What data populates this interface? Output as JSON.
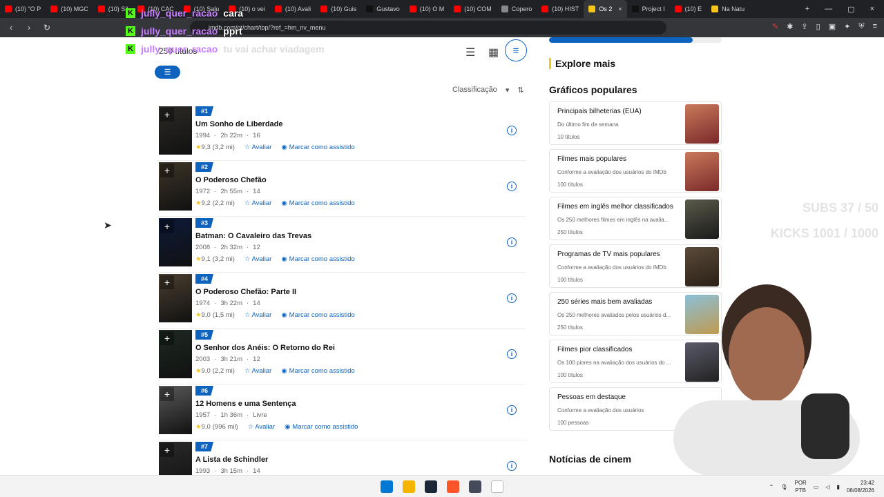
{
  "browser": {
    "tabs": [
      {
        "label": "(10) \"O P",
        "color": "#ff0000"
      },
      {
        "label": "(10) MGC",
        "color": "#ff0000"
      },
      {
        "label": "(10) Sil",
        "color": "#ff0000"
      },
      {
        "label": "(10) CAC",
        "color": "#ff0000"
      },
      {
        "label": "(10) Salu",
        "color": "#ff0000"
      },
      {
        "label": "(10) o vei",
        "color": "#ff0000"
      },
      {
        "label": "(10) Avali",
        "color": "#ff0000"
      },
      {
        "label": "(10) Guis",
        "color": "#ff0000"
      },
      {
        "label": "Gustavo",
        "color": "#111111"
      },
      {
        "label": "(10) O M",
        "color": "#ff0000"
      },
      {
        "label": "(10) COM",
        "color": "#ff0000"
      },
      {
        "label": "Copero",
        "color": "#888888"
      },
      {
        "label": "(10) HIST",
        "color": "#ff0000"
      },
      {
        "label": "Os 2",
        "color": "#f5c518",
        "active": true
      },
      {
        "label": "Project I",
        "color": "#111111"
      },
      {
        "label": "(10) E",
        "color": "#ff0000"
      },
      {
        "label": "Na Natu",
        "color": "#f5c518"
      }
    ],
    "url": "imdb.com/pt/chart/top/?ref_=hm_nv_menu",
    "tab_close": "×",
    "new_tab": "+"
  },
  "chat": [
    {
      "user": "jully_quer_racao",
      "message": "cara"
    },
    {
      "user": "jully_quer_racao",
      "message": "pprt"
    },
    {
      "user": "jully_quer_racao",
      "message": "tu vai achar viadagem"
    }
  ],
  "chat_badge": "K",
  "view": {
    "count": "250 títulos",
    "list_icon": "☰",
    "grid_icon": "▦",
    "menu_icon": "≡",
    "filter_icon": "☰",
    "sort_label": "Classificação",
    "sort_caret": "▾",
    "sort_toggle": "⇅"
  },
  "movies": [
    {
      "rank": "#1",
      "title": "Um Sonho de Liberdade",
      "year": "1994",
      "duration": "2h 22m",
      "rating_age": "16",
      "rating": "9,3",
      "votes": "(3,2 mi)"
    },
    {
      "rank": "#2",
      "title": "O Poderoso Chefão",
      "year": "1972",
      "duration": "2h 55m",
      "rating_age": "14",
      "rating": "9,2",
      "votes": "(2,2 mi)"
    },
    {
      "rank": "#3",
      "title": "Batman: O Cavaleiro das Trevas",
      "year": "2008",
      "duration": "2h 32m",
      "rating_age": "12",
      "rating": "9,1",
      "votes": "(3,2 mi)"
    },
    {
      "rank": "#4",
      "title": "O Poderoso Chefão: Parte II",
      "year": "1974",
      "duration": "3h 22m",
      "rating_age": "14",
      "rating": "9,0",
      "votes": "(1,5 mi)"
    },
    {
      "rank": "#5",
      "title": "O Senhor dos Anéis: O Retorno do Rei",
      "year": "2003",
      "duration": "3h 21m",
      "rating_age": "12",
      "rating": "9,0",
      "votes": "(2,2 mi)"
    },
    {
      "rank": "#6",
      "title": "12 Homens e uma Sentença",
      "year": "1957",
      "duration": "1h 36m",
      "rating_age": "Livre",
      "rating": "9,0",
      "votes": "(996 mil)"
    },
    {
      "rank": "#7",
      "title": "A Lista de Schindler",
      "year": "1993",
      "duration": "3h 15m",
      "rating_age": "14",
      "rating": "",
      "votes": ""
    }
  ],
  "movie_actions": {
    "rate": "Avaliar",
    "watched": "Marcar como assistido",
    "plus": "+",
    "info": "i",
    "star": "★",
    "rate_icon": "☆",
    "eye_icon": "◉",
    "sep": "·"
  },
  "sidebar": {
    "progress": 0.83,
    "explore": "Explore mais",
    "popular": "Gráficos populares",
    "cards": [
      {
        "title": "Principais bilheterias (EUA)",
        "subtitle": "Do último fim de semana",
        "count": "10 títulos"
      },
      {
        "title": "Filmes mais populares",
        "subtitle": "Conforme a avaliação dos usuários do IMDb",
        "count": "100 títulos"
      },
      {
        "title": "Filmes em inglês melhor classificados",
        "subtitle": "Os 250 melhores filmes em inglês na avalia...",
        "count": "250 títulos"
      },
      {
        "title": "Programas de TV mais populares",
        "subtitle": "Conforme a avaliação dos usuários do IMDb",
        "count": "100 títulos"
      },
      {
        "title": "250 séries mais bem avaliadas",
        "subtitle": "Os 250 melhores avaliados pelos usuários d...",
        "count": "250 títulos"
      },
      {
        "title": "Filmes pior classificados",
        "subtitle": "Os 100 piores na avaliação dos usuários do ...",
        "count": "100 títulos"
      },
      {
        "title": "Pessoas em destaque",
        "subtitle": "Conforme a avaliação dos usuários",
        "count": "100 pessoas"
      }
    ],
    "news": "Notícias de cinem"
  },
  "overlay": {
    "subs": "SUBS 37 / 50",
    "kicks": "KICKS 1001 / 1000"
  },
  "taskbar": {
    "lang": "POR",
    "lang2": "PTB",
    "time": "23:42",
    "date": "06/08/2026",
    "apps": [
      "#0078d4",
      "#f4b400",
      "#1b2838",
      "#fb542b",
      "#444a5a",
      "#ffffff"
    ]
  }
}
